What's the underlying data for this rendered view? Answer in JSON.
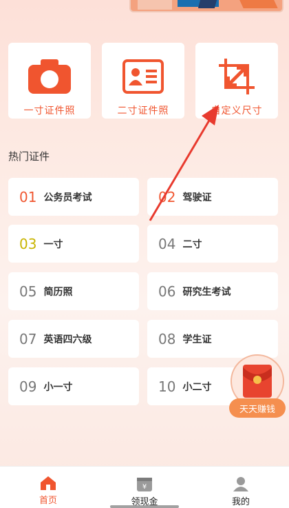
{
  "features": [
    {
      "label": "一寸证件照",
      "icon": "camera-icon"
    },
    {
      "label": "二寸证件照",
      "icon": "id-card-icon"
    },
    {
      "label": "自定义尺寸",
      "icon": "crop-resize-icon"
    }
  ],
  "section": {
    "title": "热门证件"
  },
  "items": [
    {
      "num": "01",
      "label": "公务员考试",
      "color": "#f0552f"
    },
    {
      "num": "02",
      "label": "驾驶证",
      "color": "#f0552f"
    },
    {
      "num": "03",
      "label": "一寸",
      "color": "#c8b400"
    },
    {
      "num": "04",
      "label": "二寸",
      "color": "#777777"
    },
    {
      "num": "05",
      "label": "简历照",
      "color": "#777777"
    },
    {
      "num": "06",
      "label": "研究生考试",
      "color": "#777777"
    },
    {
      "num": "07",
      "label": "英语四六级",
      "color": "#777777"
    },
    {
      "num": "08",
      "label": "学生证",
      "color": "#777777"
    },
    {
      "num": "09",
      "label": "小一寸",
      "color": "#777777"
    },
    {
      "num": "10",
      "label": "小二寸",
      "color": "#777777"
    }
  ],
  "float_button": {
    "label": "天天赚钱",
    "icon": "red-envelope-icon"
  },
  "tabbar": [
    {
      "label": "首页",
      "icon": "home-icon",
      "active": true
    },
    {
      "label": "领现金",
      "icon": "cash-icon",
      "active": false
    },
    {
      "label": "我的",
      "icon": "user-icon",
      "active": false
    }
  ],
  "colors": {
    "accent": "#f0552f",
    "float": "#f58f4f"
  }
}
